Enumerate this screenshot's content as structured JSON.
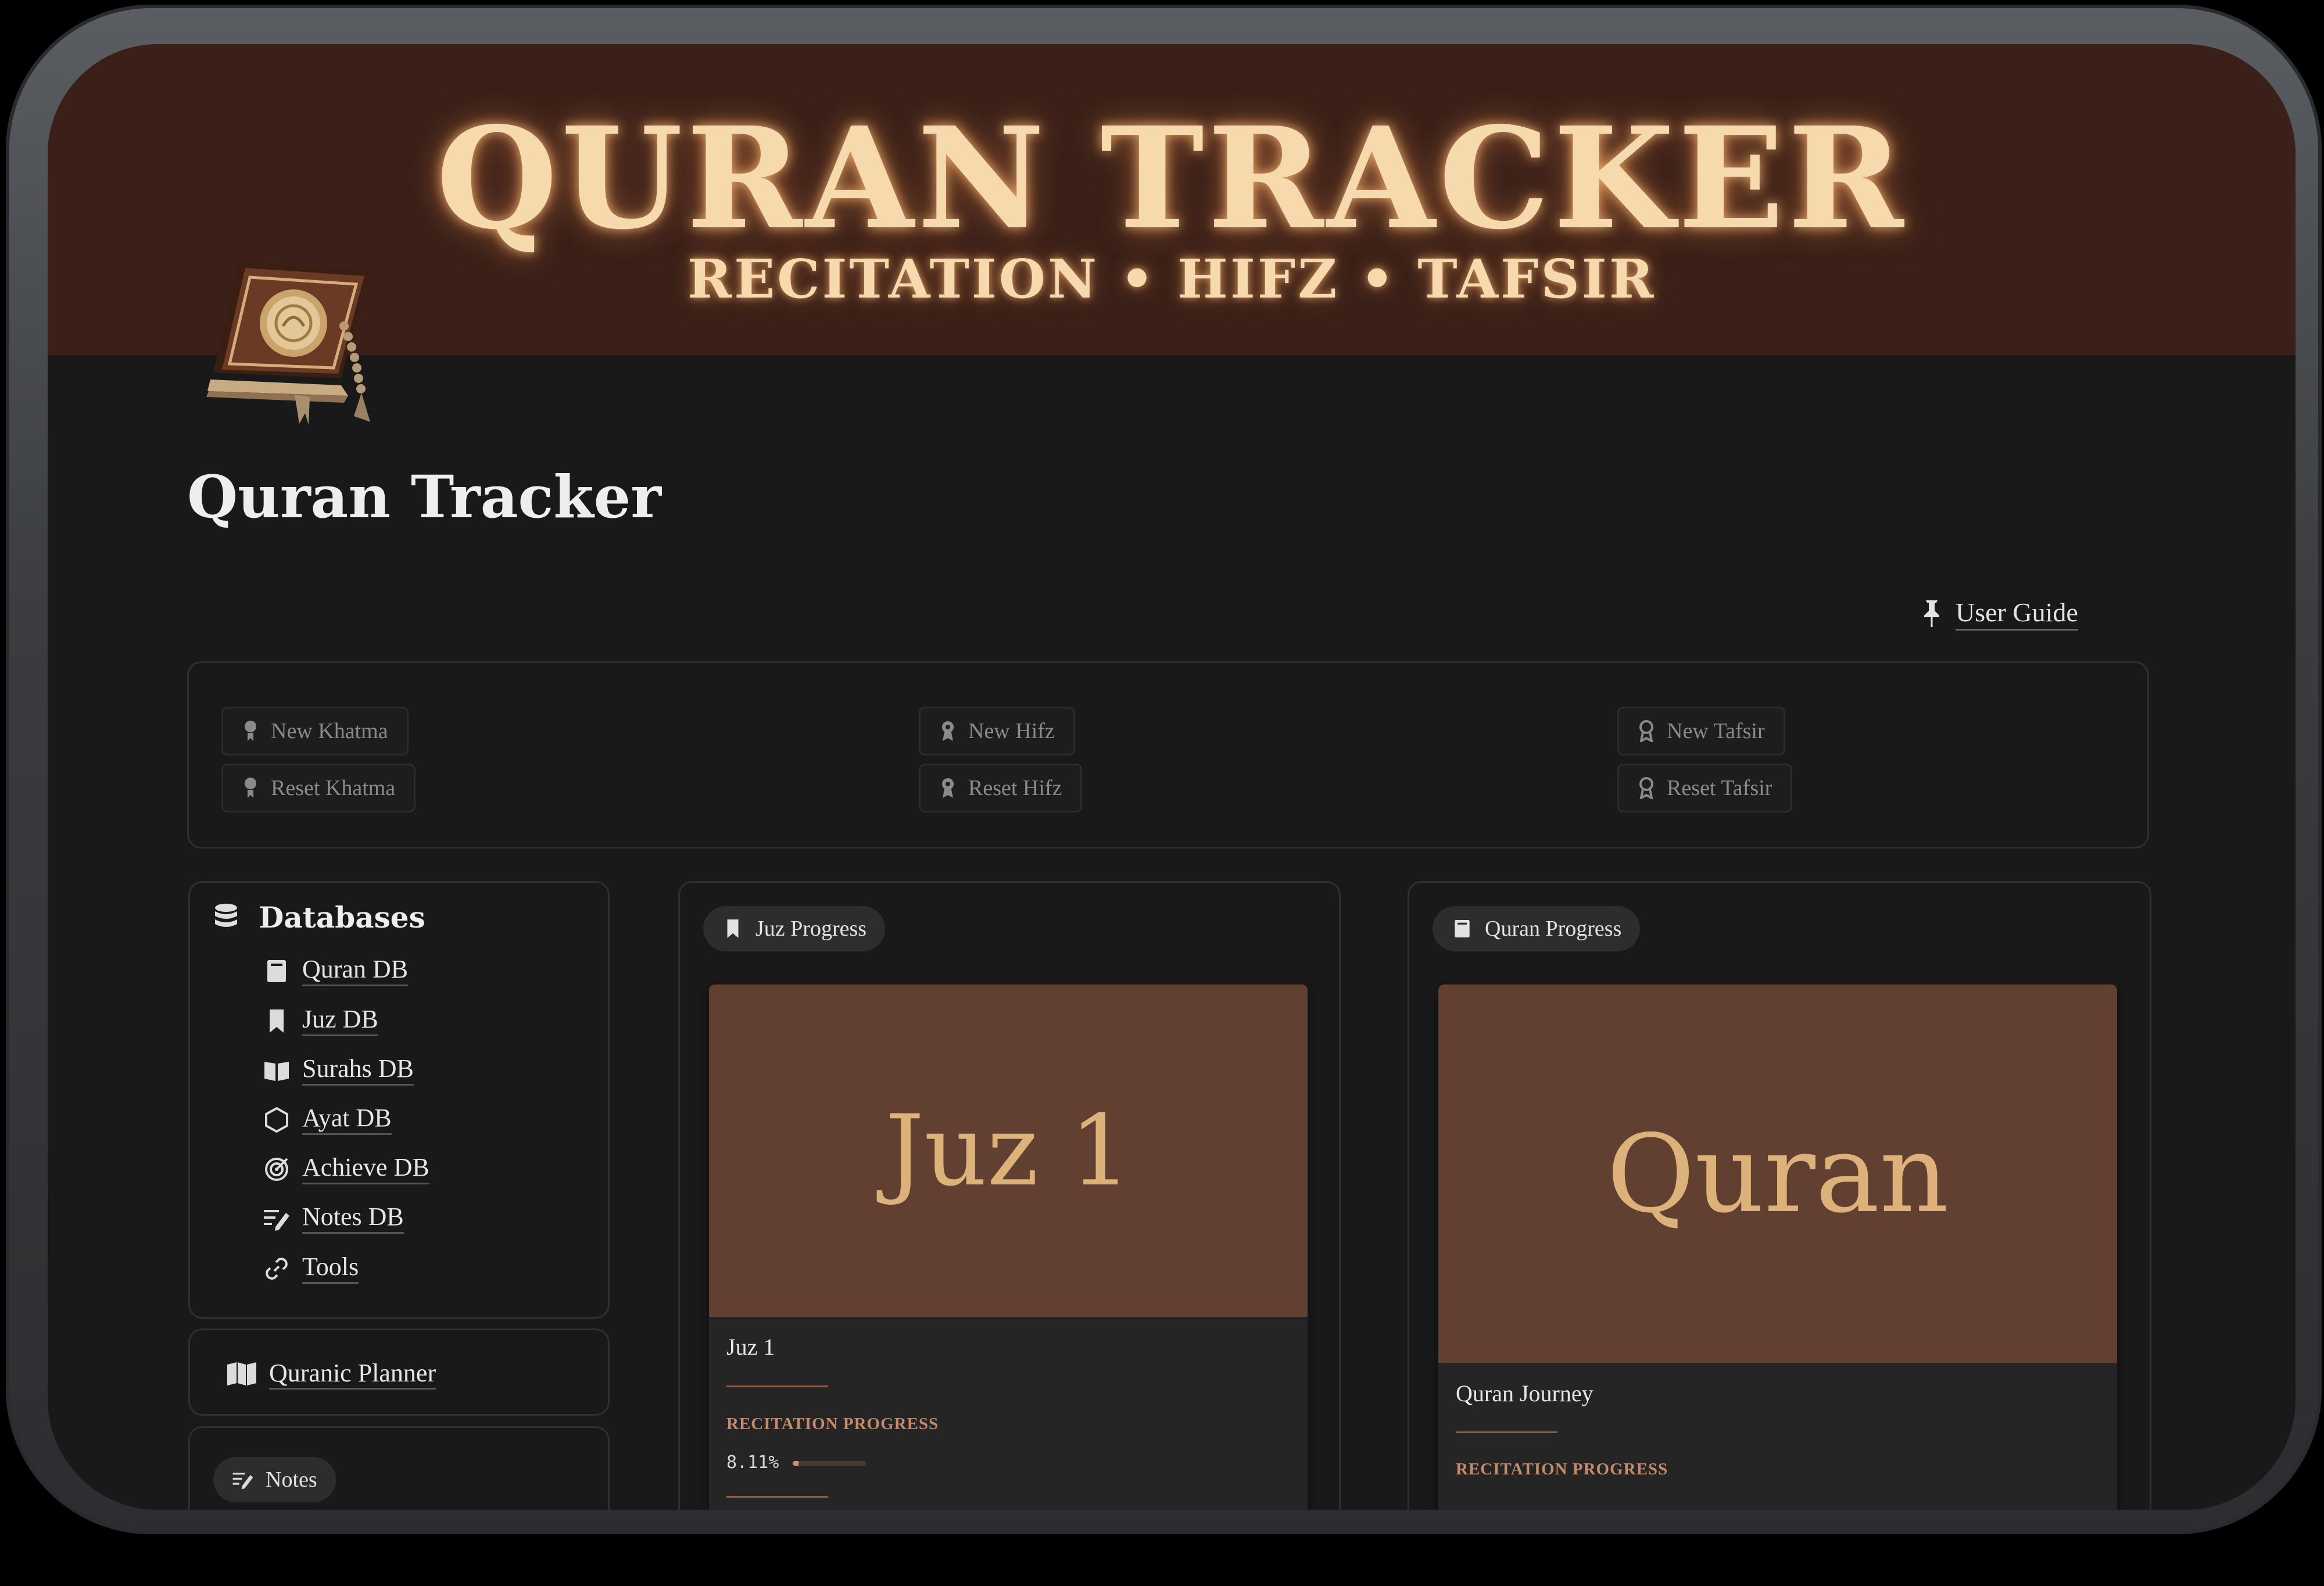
{
  "banner": {
    "title": "QURAN TRACKER",
    "subtitle": "RECITATION  • HIFZ • TAFSIR"
  },
  "page": {
    "title": "Quran Tracker",
    "user_guide_label": "User Guide"
  },
  "action_buttons": {
    "new_khatma": "New Khatma",
    "reset_khatma": "Reset Khatma",
    "new_hifz": "New Hifz",
    "reset_hifz": "Reset Hifz",
    "new_tafsir": "New Tafsir",
    "reset_tafsir": "Reset Tafsir"
  },
  "databases": {
    "heading": "Databases",
    "items": [
      {
        "label": "Quran DB",
        "icon": "book-icon"
      },
      {
        "label": "Juz DB",
        "icon": "bookmark-icon"
      },
      {
        "label": "Surahs DB",
        "icon": "open-book-icon"
      },
      {
        "label": "Ayat DB",
        "icon": "hexagon-icon"
      },
      {
        "label": "Achieve DB",
        "icon": "target-icon"
      },
      {
        "label": "Notes DB",
        "icon": "notes-icon"
      },
      {
        "label": "Tools",
        "icon": "link-icon"
      }
    ]
  },
  "planner": {
    "label": "Quranic Planner"
  },
  "notes": {
    "label": "Notes"
  },
  "juz_progress": {
    "tab_label": "Juz Progress",
    "cover_text": "Juz 1",
    "title": "Juz 1",
    "progress_label": "RECITATION PROGRESS",
    "progress_text": "8.11%",
    "progress_value": 0.0811
  },
  "quran_progress": {
    "tab_label": "Quran Progress",
    "cover_text": "Quran",
    "title": "Quran Journey",
    "progress_label": "RECITATION PROGRESS"
  },
  "colors": {
    "banner": "#3a2018",
    "background": "#191919",
    "cover": "#613f31",
    "accent": "#c48a6b",
    "glow_text": "#f6d9ad"
  }
}
